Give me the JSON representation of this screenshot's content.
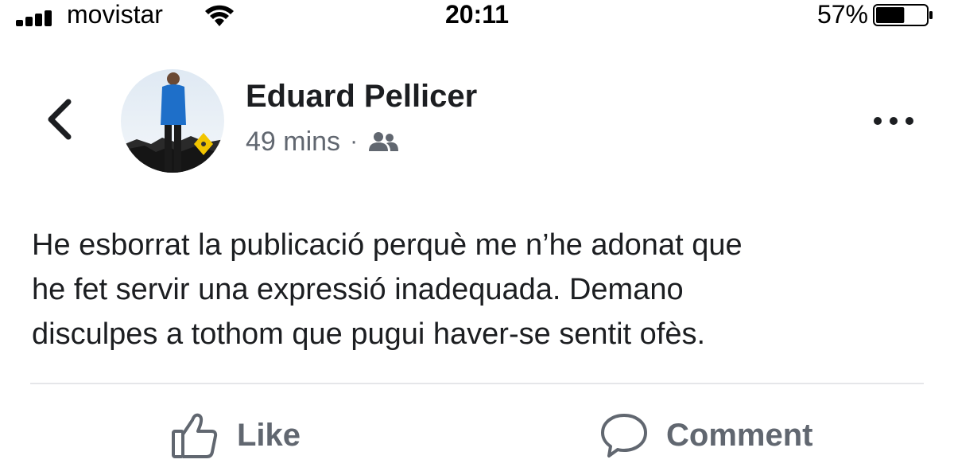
{
  "status_bar": {
    "carrier": "movistar",
    "time": "20:11",
    "battery_percent": "57%",
    "battery_level": 0.57,
    "icons": [
      "signal-icon",
      "wifi-icon",
      "battery-icon"
    ]
  },
  "post": {
    "author": "Eduard Pellicer",
    "timestamp": "49 mins",
    "separator": "·",
    "audience_icon": "friends-icon",
    "text": "He esborrat la publicació perquè me n’he adonat que\nhe fet servir una expressió inadequada. Demano\ndisculpes a tothom que pugui haver-se sentit ofès."
  },
  "actions": {
    "like_label": "Like",
    "comment_label": "Comment"
  },
  "colors": {
    "text_primary": "#1c1e21",
    "text_secondary": "#616770",
    "divider": "#e5e6e9"
  }
}
